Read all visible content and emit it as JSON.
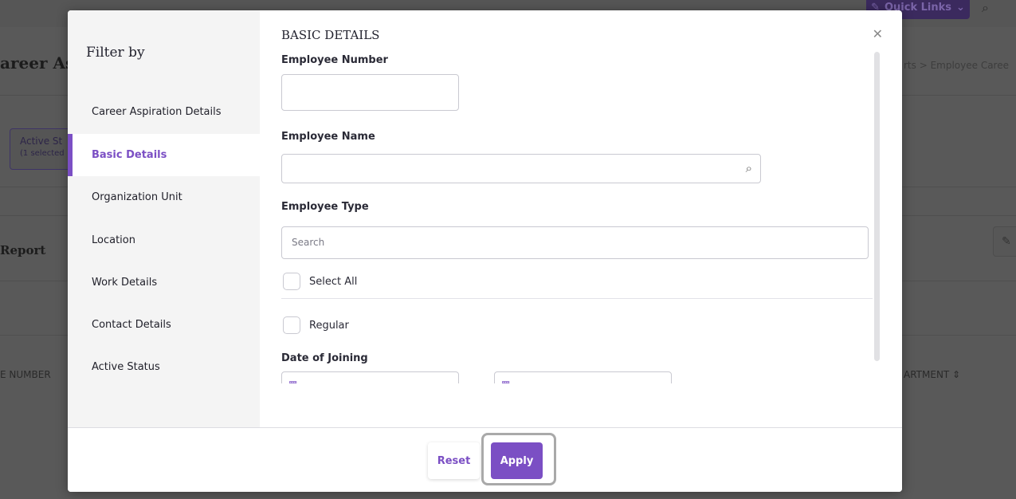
{
  "background": {
    "quick_links_label": "Quick Links",
    "title": "areer Asp",
    "breadcrumb": "rts  >  Employee Caree",
    "chip_label": "Active St",
    "chip_sub": "(1 selected",
    "report_title": "Report",
    "col_number": "E NUMBER",
    "col_department": "ARTMENT ⇕"
  },
  "sidebar": {
    "title": "Filter by",
    "items": [
      {
        "label": "Career Aspiration Details"
      },
      {
        "label": "Basic Details"
      },
      {
        "label": "Organization Unit"
      },
      {
        "label": "Location"
      },
      {
        "label": "Work Details"
      },
      {
        "label": "Contact Details"
      },
      {
        "label": "Active Status"
      }
    ],
    "active_index": 1
  },
  "content": {
    "section_title": "BASIC DETAILS",
    "employee_number_label": "Employee Number",
    "employee_name_label": "Employee Name",
    "employee_type_label": "Employee Type",
    "employee_type_search_placeholder": "Search",
    "select_all_label": "Select All",
    "regular_label": "Regular",
    "date_of_joining_label": "Date of Joining"
  },
  "footer": {
    "reset_label": "Reset",
    "apply_label": "Apply"
  },
  "colors": {
    "accent": "#7b4fc4",
    "highlight_border": "#a9a9a9"
  },
  "icons": {
    "close": "close-icon",
    "search": "search-icon",
    "calendar": "calendar-icon"
  }
}
